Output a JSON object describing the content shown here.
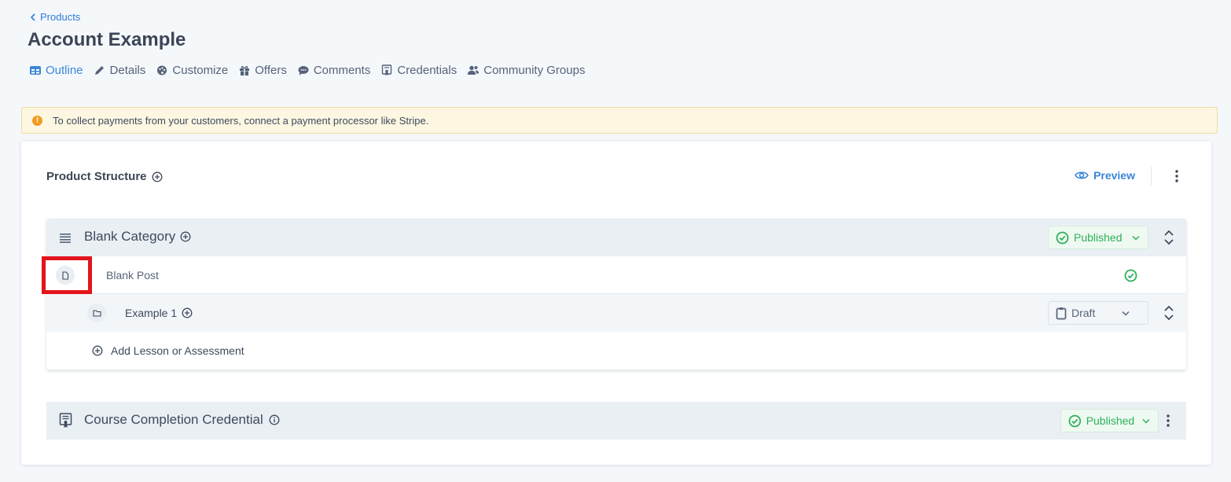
{
  "breadcrumb": {
    "label": "Products"
  },
  "page": {
    "title": "Account Example"
  },
  "tabs": [
    {
      "label": "Outline",
      "icon": "table-icon",
      "active": true
    },
    {
      "label": "Details",
      "icon": "pencil-icon"
    },
    {
      "label": "Customize",
      "icon": "palette-icon"
    },
    {
      "label": "Offers",
      "icon": "gift-icon"
    },
    {
      "label": "Comments",
      "icon": "comment-icon"
    },
    {
      "label": "Credentials",
      "icon": "certificate-icon"
    },
    {
      "label": "Community Groups",
      "icon": "users-icon"
    }
  ],
  "alert": {
    "text": "To collect payments from your customers, connect a payment processor like Stripe.",
    "icon": "!"
  },
  "structure": {
    "title": "Product Structure",
    "preview_label": "Preview"
  },
  "category": {
    "title": "Blank Category",
    "status": "Published",
    "post": {
      "label": "Blank Post"
    },
    "subcategory": {
      "label": "Example 1",
      "status": "Draft"
    },
    "add_label": "Add Lesson or Assessment"
  },
  "credential": {
    "title": "Course Completion Credential",
    "status": "Published"
  },
  "colors": {
    "accent": "#3b86d8",
    "published": "#2eb05b",
    "alert_bg": "#fdf7e2",
    "alert_icon": "#f09c1f",
    "highlight": "#e3151b"
  }
}
